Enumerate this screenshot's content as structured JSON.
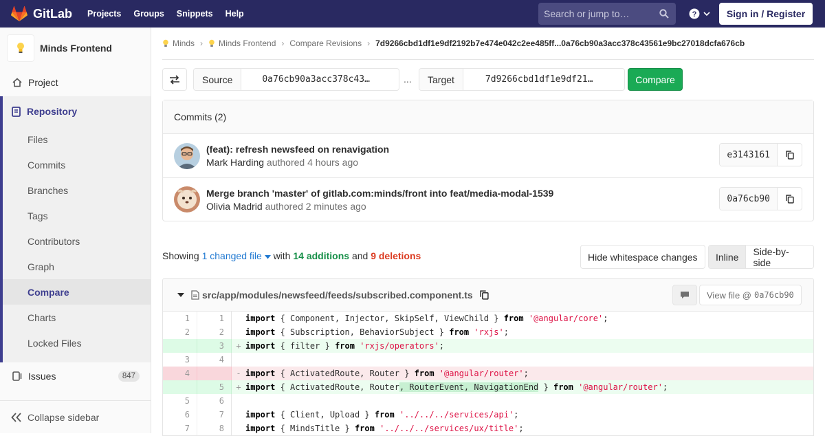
{
  "navbar": {
    "brand": "GitLab",
    "links": [
      "Projects",
      "Groups",
      "Snippets",
      "Help"
    ],
    "search_placeholder": "Search or jump to…",
    "sign_in": "Sign in / Register",
    "colors": {
      "background": "#292961",
      "logo_orange": "#e24329"
    }
  },
  "sidebar": {
    "project_name": "Minds Frontend",
    "project_item": "Project",
    "repository_label": "Repository",
    "repository_items": [
      "Files",
      "Commits",
      "Branches",
      "Tags",
      "Contributors",
      "Graph",
      "Compare",
      "Charts",
      "Locked Files"
    ],
    "active_item": "Compare",
    "issues_label": "Issues",
    "issues_count": "847",
    "collapse_label": "Collapse sidebar"
  },
  "breadcrumb": {
    "items": [
      "Minds",
      "Minds Frontend",
      "Compare Revisions"
    ],
    "current": "7d9266cbd1df1e9df2192b7e474e042c2ee485ff...0a76cb90a3acc378c43561e9bc27018dcfa676cb"
  },
  "compare": {
    "source_label": "Source",
    "source_value": "0a76cb90a3acc378c43…",
    "separator": "...",
    "target_label": "Target",
    "target_value": "7d9266cbd1df1e9df21…",
    "button": "Compare"
  },
  "commits": {
    "header": "Commits (2)",
    "items": [
      {
        "title": "(feat): refresh newsfeed on renavigation",
        "author": "Mark Harding",
        "authored": "authored 4 hours ago",
        "sha": "e3143161"
      },
      {
        "title": "Merge branch 'master' of gitlab.com:minds/front into feat/media-modal-1539",
        "author": "Olivia Madrid",
        "authored": "authored 2 minutes ago",
        "sha": "0a76cb90"
      }
    ]
  },
  "stats": {
    "showing": "Showing",
    "changed": "1 changed file",
    "with": "with",
    "additions": "14 additions",
    "and": "and",
    "deletions": "9 deletions",
    "whitespace_btn": "Hide whitespace changes",
    "inline": "Inline",
    "side_by_side": "Side-by-side"
  },
  "file": {
    "path": "src/app/modules/newsfeed/feeds/subscribed.component.ts",
    "view_file": "View file @",
    "view_sha": "0a76cb90"
  },
  "diff_lines": [
    {
      "old": "1",
      "new": "1",
      "type": "ctx",
      "sign": ""
    },
    {
      "old": "2",
      "new": "2",
      "type": "ctx",
      "sign": ""
    },
    {
      "old": "",
      "new": "3",
      "type": "add",
      "sign": "+"
    },
    {
      "old": "3",
      "new": "4",
      "type": "ctx",
      "sign": ""
    },
    {
      "old": "4",
      "new": "",
      "type": "del",
      "sign": "-"
    },
    {
      "old": "",
      "new": "5",
      "type": "add",
      "sign": "+"
    },
    {
      "old": "5",
      "new": "6",
      "type": "ctx",
      "sign": ""
    },
    {
      "old": "6",
      "new": "7",
      "type": "ctx",
      "sign": ""
    },
    {
      "old": "7",
      "new": "8",
      "type": "ctx",
      "sign": ""
    }
  ],
  "code": {
    "import": "import",
    "from": "from",
    "l1_body": " { Component, Injector, SkipSelf, ViewChild } ",
    "l1_str": "'@angular/core'",
    "l2_body": " { Subscription, BehaviorSubject } ",
    "l2_str": "'rxjs'",
    "l3_body": " { filter } ",
    "l3_str": "'rxjs/operators'",
    "l5_body": " { ActivatedRoute, Router } ",
    "l5_str": "'@angular/router'",
    "l6_body_a": " { ActivatedRoute, Router",
    "l6_hl": ", RouterEvent, NavigationEnd",
    "l6_body_b": " } ",
    "l6_str": "'@angular/router'",
    "l8_body": " { Client, Upload } ",
    "l8_str": "'../../../services/api'",
    "l9_body": " { MindsTitle } ",
    "l9_str": "'../../../services/ux/title'",
    "semi": ";"
  }
}
